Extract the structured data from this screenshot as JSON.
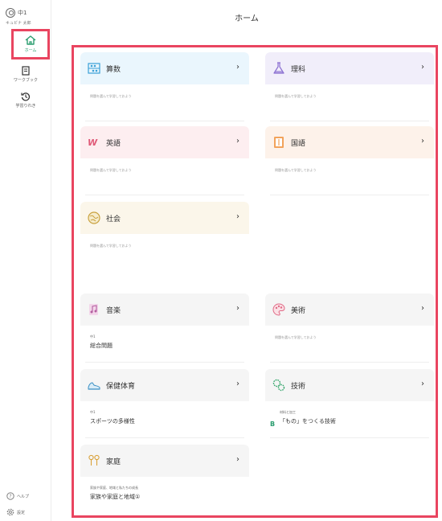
{
  "sidebar": {
    "grade": "中1",
    "user_name": "キュビナ 太郎",
    "home_label": "ホーム",
    "workbook_label": "ワークブック",
    "history_label": "学習りれき",
    "help_label": "ヘルプ",
    "settings_label": "設定"
  },
  "header": {
    "title": "ホーム"
  },
  "hint": "問題を選んで学習しておよう",
  "subjects": [
    {
      "id": "math",
      "title": "算数",
      "sub": "問題を選んで学習しておよう",
      "icon": "abacus-icon"
    },
    {
      "id": "science",
      "title": "理科",
      "sub": "問題を選んで学習しておよう",
      "icon": "flask-icon"
    },
    {
      "id": "english",
      "title": "英語",
      "sub": "問題を選んで学習しておよう",
      "icon": "alphabet-icon"
    },
    {
      "id": "japanese",
      "title": "国語",
      "sub": "問題を選んで学習しておよう",
      "icon": "book-icon"
    },
    {
      "id": "social",
      "title": "社会",
      "sub": "問題を選んで学習しておよう",
      "icon": "globe-icon"
    },
    {
      "id": "music",
      "title": "音楽",
      "unit_small": "中1",
      "unit_name": "総合問題",
      "icon": "music-note-icon"
    },
    {
      "id": "art",
      "title": "美術",
      "sub": "問題を選んで学習しておよう",
      "icon": "palette-icon"
    },
    {
      "id": "pe",
      "title": "保健体育",
      "unit_small": "中1",
      "unit_name": "スポーツの多様性",
      "icon": "shoe-icon"
    },
    {
      "id": "tech",
      "title": "技術",
      "badge": "B",
      "unit_small": "材料と加工",
      "unit_name": "「もの」をつくる技術",
      "icon": "gears-icon"
    },
    {
      "id": "home",
      "title": "家庭",
      "unit_small": "家族や家庭、地域と私たちの成長",
      "unit_name": "家族や家庭と地域①",
      "icon": "people-icon"
    }
  ],
  "chevron": "›",
  "colors": {
    "accent": "#e94560",
    "green": "#2a9d6f"
  }
}
